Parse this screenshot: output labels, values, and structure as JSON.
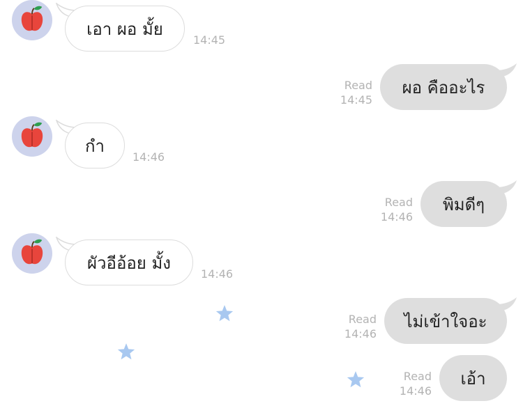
{
  "conversation": {
    "messages": [
      {
        "direction": "incoming",
        "text": "เอา ผอ มั้ย",
        "time": "14:45",
        "avatar_icon": "apple-icon"
      },
      {
        "direction": "outgoing",
        "text": "ผอ คืออะไร",
        "status": "Read",
        "time": "14:45"
      },
      {
        "direction": "incoming",
        "text": "กำ",
        "time": "14:46",
        "avatar_icon": "apple-icon"
      },
      {
        "direction": "outgoing",
        "text": "พิมดีๆ",
        "status": "Read",
        "time": "14:46"
      },
      {
        "direction": "incoming",
        "text": "ผัวอีอ้อย มั้ง",
        "time": "14:46",
        "avatar_icon": "apple-icon"
      },
      {
        "direction": "outgoing",
        "text": "ไม่เข้าใจอะ",
        "status": "Read",
        "time": "14:46"
      },
      {
        "direction": "outgoing",
        "text": "เอ้า",
        "status": "Read",
        "time": "14:46"
      }
    ]
  },
  "decorations": {
    "stars": [
      "star-icon",
      "star-icon",
      "star-icon"
    ],
    "star_color": "#a8c8f0"
  },
  "colors": {
    "background": "#ffffff",
    "incoming_bubble": "#ffffff",
    "incoming_border": "#dcdcdc",
    "outgoing_bubble": "#dedede",
    "meta_text": "#b3b3b3",
    "avatar_bg": "#cdd3ec",
    "apple_red": "#e8453c",
    "leaf_green": "#2e9e4f"
  }
}
